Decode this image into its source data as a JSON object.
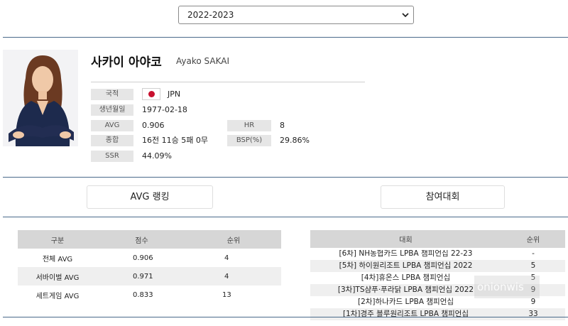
{
  "season": {
    "selected": "2022-2023"
  },
  "player": {
    "name_ko": "사카이 아야코",
    "name_en": "Ayako SAKAI",
    "labels": {
      "nationality": "국적",
      "birthdate": "생년월일",
      "avg": "AVG",
      "hr": "HR",
      "record": "종합",
      "bsp": "BSP(%)",
      "ssr": "SSR"
    },
    "values": {
      "nationality": "JPN",
      "birthdate": "1977-02-18",
      "avg": "0.906",
      "hr": "8",
      "record": "16전 11승 5패 0무",
      "bsp": "29.86%",
      "ssr": "44.09%"
    },
    "flag_color": "#c8102e"
  },
  "tabs": {
    "ranking": "AVG 랭킹",
    "tournaments": "참여대회"
  },
  "ranking_table": {
    "headers": [
      "구분",
      "점수",
      "순위"
    ],
    "rows": [
      [
        "전체 AVG",
        "0.906",
        "4"
      ],
      [
        "서바이벌 AVG",
        "0.971",
        "4"
      ],
      [
        "세트게임 AVG",
        "0.833",
        "13"
      ]
    ]
  },
  "tournament_table": {
    "headers": [
      "대회",
      "순위"
    ],
    "rows": [
      [
        "[6차] NH농협카드 LPBA 챔피언십 22-23",
        "-"
      ],
      [
        "[5차] 하이원리조트 LPBA 챔피언십 2022",
        "5"
      ],
      [
        "[4차]휴온스 LPBA 챔피언십",
        "5"
      ],
      [
        "[3차]TS샴푸·푸라닭 LPBA 챔피언십 2022",
        "9"
      ],
      [
        "[2차]하나카드 LPBA 챔피언십",
        "9"
      ],
      [
        "[1차]경주 블루원리조트 LPBA 챔피언십",
        "33"
      ]
    ]
  },
  "watermark": "onionwis"
}
